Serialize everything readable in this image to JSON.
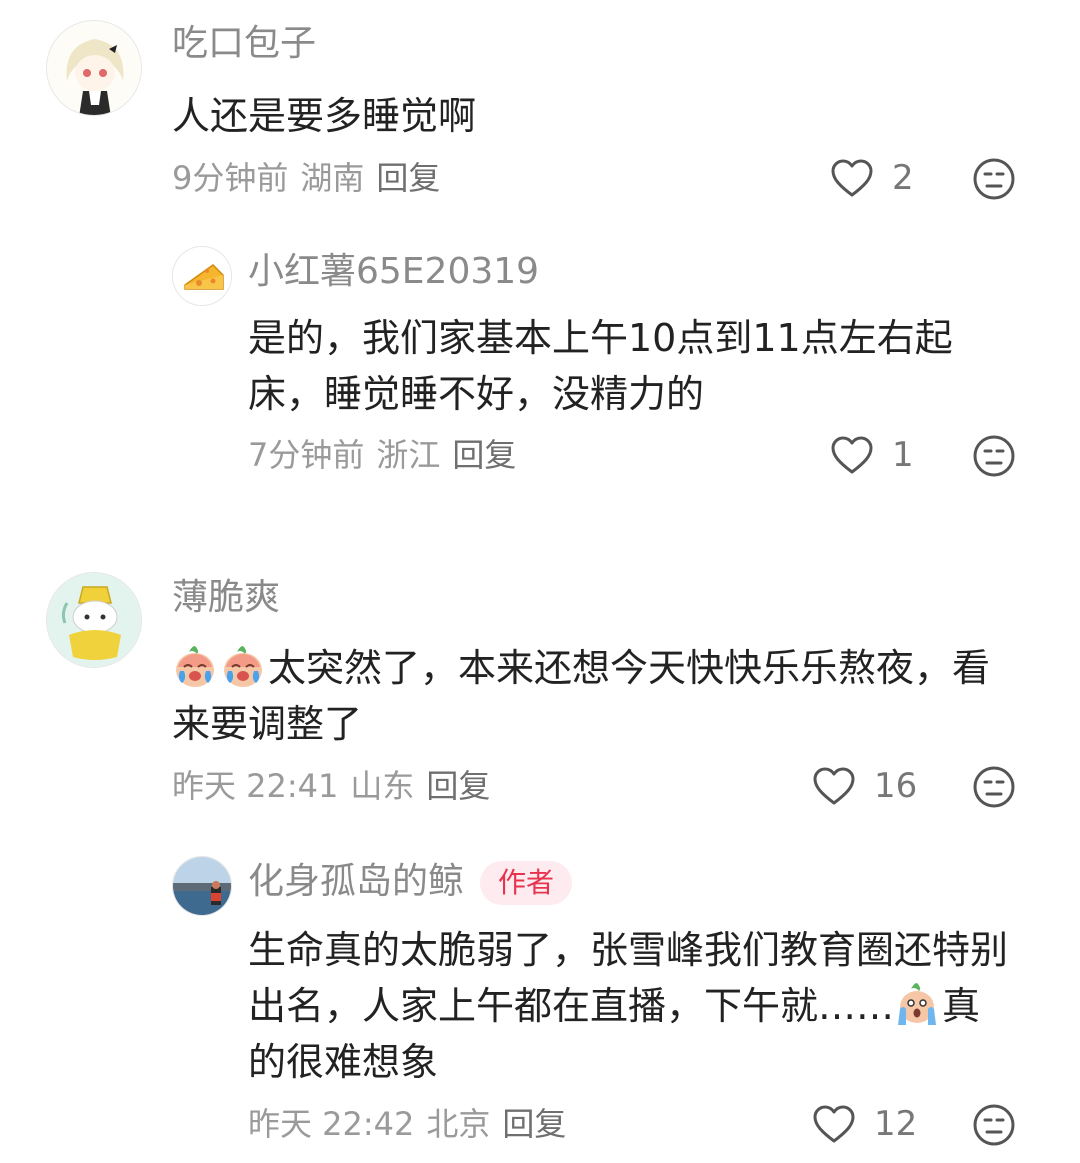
{
  "comments": [
    {
      "name": "吃口包子",
      "text": "人还是要多睡觉啊",
      "time": "9分钟前",
      "location": "湖南",
      "reply_label": "回复",
      "likes": "2",
      "replies": [
        {
          "name": "小红薯65E20319",
          "text": "是的，我们家基本上午10点到11点左右起床，睡觉睡不好，没精力的",
          "time": "7分钟前",
          "location": "浙江",
          "reply_label": "回复",
          "likes": "1"
        }
      ]
    },
    {
      "name": "薄脆爽",
      "text": "太突然了，本来还想今天快快乐乐熬夜，看来要调整了",
      "time": "昨天 22:41",
      "location": "山东",
      "reply_label": "回复",
      "likes": "16",
      "replies": [
        {
          "name": "化身孤岛的鲸",
          "badge": "作者",
          "text_a": "生命真的太脆弱了，张雪峰我们教育圈还特别出名，人家上午都在直播，下午就……",
          "text_b": "真的很难想象",
          "time": "昨天 22:42",
          "location": "北京",
          "reply_label": "回复",
          "likes": "12"
        }
      ]
    }
  ],
  "colors": {
    "author_badge_bg": "#fdebef",
    "author_badge_text": "#e8334f"
  }
}
